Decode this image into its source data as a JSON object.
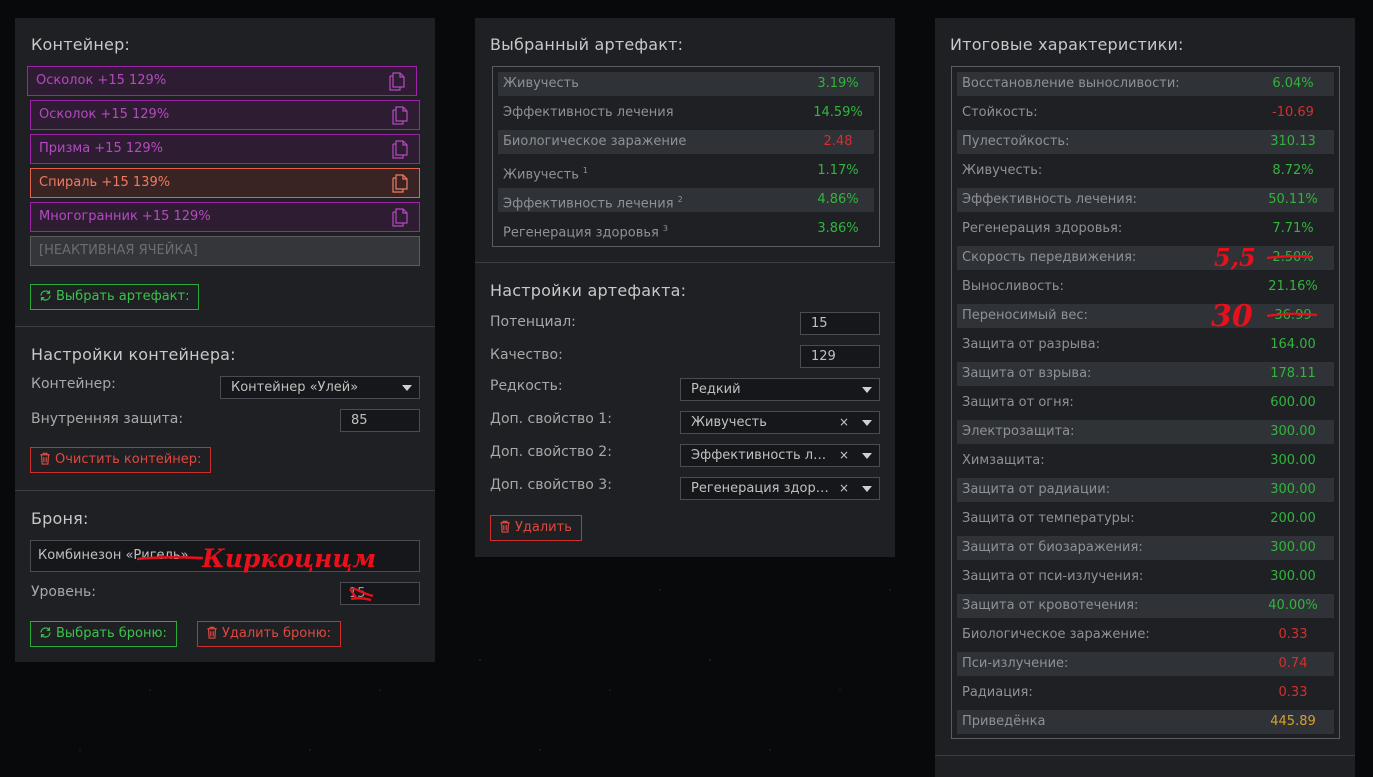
{
  "container_panel": {
    "title": "Контейнер:",
    "slots": [
      {
        "label": "Осколок +15 129%",
        "style": "purple"
      },
      {
        "label": "Осколок +15 129%",
        "style": "purple"
      },
      {
        "label": "Призма +15 129%",
        "style": "purple"
      },
      {
        "label": "Спираль +15 139%",
        "style": "orange"
      },
      {
        "label": "Многогранник +15 129%",
        "style": "purple"
      },
      {
        "label": "[НЕАКТИВНАЯ ЯЧЕЙКА]",
        "style": "inactive"
      }
    ],
    "select_artifact_button": "Выбрать артефакт:",
    "settings_title": "Настройки контейнера:",
    "container_label": "Контейнер:",
    "container_value": "Контейнер «Улей»",
    "inner_protection_label": "Внутренняя защита:",
    "inner_protection_value": "85",
    "clear_button": "Очистить контейнер:",
    "armor_title": "Броня:",
    "armor_value": "Комбинезон «Ригель»",
    "level_label": "Уровень:",
    "level_value": "15",
    "select_armor_button": "Выбрать броню:",
    "delete_armor_button": "Удалить броню:",
    "handwritten_armor": "Киркоцнцм"
  },
  "artifact_panel": {
    "title": "Выбранный артефакт:",
    "stats": [
      {
        "label": "Живучесть",
        "sup": "",
        "value": "3.19%",
        "color": "green"
      },
      {
        "label": "Эффективность лечения",
        "sup": "",
        "value": "14.59%",
        "color": "green"
      },
      {
        "label": "Биологическое заражение",
        "sup": "",
        "value": "2.48",
        "color": "red"
      },
      {
        "label": "Живучесть",
        "sup": "1",
        "value": "1.17%",
        "color": "green"
      },
      {
        "label": "Эффективность лечения",
        "sup": "2",
        "value": "4.86%",
        "color": "green"
      },
      {
        "label": "Регенерация здоровья",
        "sup": "3",
        "value": "3.86%",
        "color": "green"
      }
    ],
    "settings_title": "Настройки артефакта:",
    "potential_label": "Потенциал:",
    "potential_value": "15",
    "quality_label": "Качество:",
    "quality_value": "129",
    "rarity_label": "Редкость:",
    "rarity_value": "Редкий",
    "prop1_label": "Доп. свойство 1:",
    "prop1_value": "Живучесть",
    "prop2_label": "Доп. свойство 2:",
    "prop2_value": "Эффективность лечения",
    "prop3_label": "Доп. свойство 3:",
    "prop3_value": "Регенерация здоровья",
    "clear_mark": "×",
    "delete_button": "Удалить"
  },
  "summary_panel": {
    "title": "Итоговые характеристики:",
    "stats": [
      {
        "label": "Восстановление выносливости:",
        "value": "6.04%",
        "color": "green"
      },
      {
        "label": "Стойкость:",
        "value": "-10.69",
        "color": "red"
      },
      {
        "label": "Пулестойкость:",
        "value": "310.13",
        "color": "green"
      },
      {
        "label": "Живучесть:",
        "value": "8.72%",
        "color": "green"
      },
      {
        "label": "Эффективность лечения:",
        "value": "50.11%",
        "color": "green"
      },
      {
        "label": "Регенерация здоровья:",
        "value": "7.71%",
        "color": "green"
      },
      {
        "label": "Скорость передвижения:",
        "value": "2.50%",
        "color": "green"
      },
      {
        "label": "Выносливость:",
        "value": "21.16%",
        "color": "green"
      },
      {
        "label": "Переносимый вес:",
        "value": "36.99",
        "color": "green"
      },
      {
        "label": "Защита от разрыва:",
        "value": "164.00",
        "color": "green"
      },
      {
        "label": "Защита от взрыва:",
        "value": "178.11",
        "color": "green"
      },
      {
        "label": "Защита от огня:",
        "value": "600.00",
        "color": "green"
      },
      {
        "label": "Электрозащита:",
        "value": "300.00",
        "color": "green"
      },
      {
        "label": "Химзащита:",
        "value": "300.00",
        "color": "green"
      },
      {
        "label": "Защита от радиации:",
        "value": "300.00",
        "color": "green"
      },
      {
        "label": "Защита от температуры:",
        "value": "200.00",
        "color": "green"
      },
      {
        "label": "Защита от биозаражения:",
        "value": "300.00",
        "color": "green"
      },
      {
        "label": "Защита от пси-излучения:",
        "value": "300.00",
        "color": "green"
      },
      {
        "label": "Защита от кровотечения:",
        "value": "40.00%",
        "color": "green"
      },
      {
        "label": "Биологическое заражение:",
        "value": "0.33",
        "color": "red"
      },
      {
        "label": "Пси-излучение:",
        "value": "0.74",
        "color": "red"
      },
      {
        "label": "Радиация:",
        "value": "0.33",
        "color": "red"
      },
      {
        "label": "Приведёнка",
        "value": "445.89",
        "color": "gold"
      }
    ],
    "handwritten_speed": "5,5",
    "handwritten_weight": "30"
  },
  "colors": {
    "green": "#32b43e",
    "red": "#d3302e",
    "gold": "#d6a12a",
    "purple": "#a020a8",
    "orange": "#e2614c"
  }
}
